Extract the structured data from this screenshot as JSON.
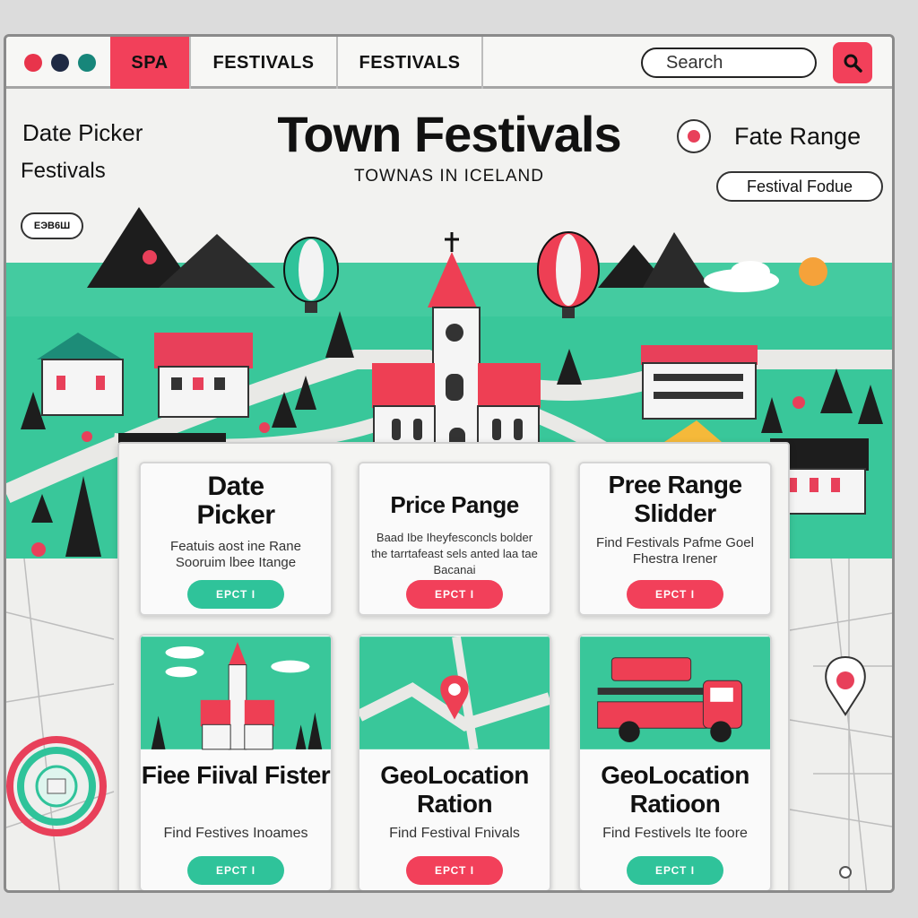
{
  "colors": {
    "accent_red": "#f2405a",
    "accent_green": "#2fc39a",
    "dark": "#1a1a1a"
  },
  "window_dots": [
    "#e8344b",
    "#1f2a44",
    "#17867a"
  ],
  "tabs": [
    {
      "label": "SPA",
      "active": true
    },
    {
      "label": "FESTIVALS",
      "active": false
    },
    {
      "label": "FESTIVALS",
      "active": false
    }
  ],
  "search": {
    "placeholder": "Search",
    "icon": "search-icon"
  },
  "hero": {
    "title": "Town Festivals",
    "subtitle": "TOWNAS IN ICELAND"
  },
  "left_labels": {
    "line1": "Date Picker",
    "line2": "Festivals",
    "pill": "ЕЭВ6Ш"
  },
  "right_labels": {
    "title": "Fate Range",
    "pill": "Festival Fodue"
  },
  "cards": [
    {
      "title": "Date Picker",
      "desc": "Featuis aost ine Rane Sooruim lbee Itange",
      "button": "ЕРСТ І",
      "button_color": "#2fc39a"
    },
    {
      "title": "Price Pange",
      "desc": "Baad Ibe Iheyfesconcls bolder the tarrtafeast sels anted laa tae Bacanai",
      "button": "ЕРСТ І",
      "button_color": "#f2405a"
    },
    {
      "title": "Pree Range Slidder",
      "desc": "Find Festivals Pafme Goel Fhestra Irener",
      "button": "ЕРСТ І",
      "button_color": "#f2405a"
    },
    {
      "title": "Fiee Fiival Fister",
      "desc": "Find Festives Inoames",
      "button": "ЕРСТ І",
      "button_color": "#2fc39a",
      "image": "church-scene"
    },
    {
      "title": "GeoLocation Ration",
      "desc": "Find Festival Fnivals",
      "button": "ЕРСТ І",
      "button_color": "#f2405a",
      "image": "map-pin-scene"
    },
    {
      "title": "GeoLocation Ratioon",
      "desc": "Find Festivels Ite foore",
      "button": "ЕРСТ І",
      "button_color": "#2fc39a",
      "image": "truck-scene"
    }
  ]
}
